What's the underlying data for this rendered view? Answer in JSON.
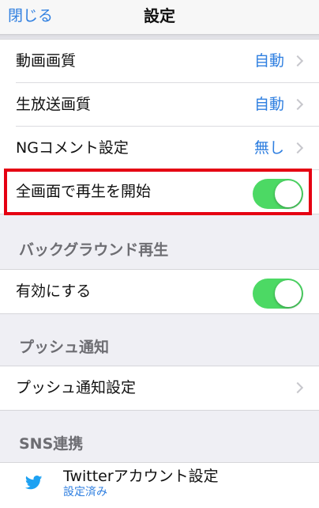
{
  "navbar": {
    "close_label": "閉じる",
    "title": "設定"
  },
  "quality_group": {
    "rows": [
      {
        "label": "動画画質",
        "value": "自動"
      },
      {
        "label": "生放送画質",
        "value": "自動"
      },
      {
        "label": "NGコメント設定",
        "value": "無し"
      },
      {
        "label": "全画面で再生を開始",
        "toggle": true
      }
    ]
  },
  "background_section": {
    "header": "バックグラウンド再生",
    "rows": [
      {
        "label": "有効にする",
        "toggle": true
      }
    ]
  },
  "push_section": {
    "header": "プッシュ通知",
    "rows": [
      {
        "label": "プッシュ通知設定"
      }
    ]
  },
  "sns_section": {
    "header": "SNS連携",
    "twitter": {
      "title": "Twitterアカウント設定",
      "status": "設定済み",
      "icon": "twitter-bird-icon"
    }
  },
  "colors": {
    "accent": "#2f7fe0",
    "toggle_on": "#4cd964",
    "highlight": "#e50012"
  }
}
